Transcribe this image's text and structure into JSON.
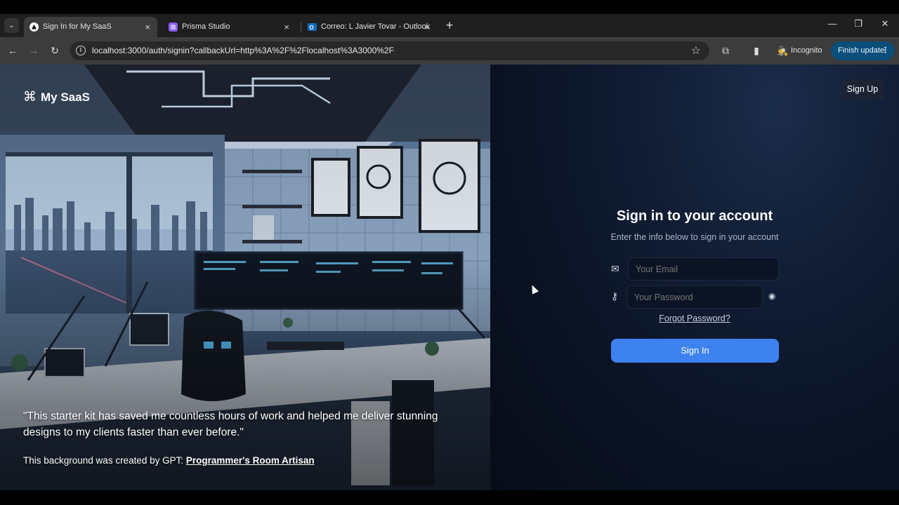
{
  "browser": {
    "tabs": [
      {
        "title": "Sign In for My SaaS",
        "close": "×"
      },
      {
        "title": "Prisma Studio",
        "close": "×"
      },
      {
        "title": "Correo: L Javier Tovar - Outlook",
        "close": "×"
      }
    ],
    "new_tab": "+",
    "url": "localhost:3000/auth/signin?callbackUrl=http%3A%2F%2Flocalhost%3A3000%2F",
    "incognito_label": "Incognito",
    "finish_update_label": "Finish update",
    "icons": {
      "back": "←",
      "forward": "→",
      "reload": "↻",
      "info": "i",
      "star": "☆",
      "extensions": "⧉",
      "sidepanel": "▮",
      "incognito": "🕵",
      "menu_dots": "⋮",
      "tab_dropdown": "⌄",
      "minimize": "—",
      "restore": "❐",
      "close": "✕"
    }
  },
  "page": {
    "brand": {
      "glyph": "⌘",
      "name": "My SaaS"
    },
    "quote": "\"This starter kit has saved me countless hours of work and helped me deliver stunning designs to my clients faster than ever before.\"",
    "credit_prefix": "This background was created by GPT: ",
    "credit_link": "Programmer's Room Artisan",
    "signup_label": "Sign Up",
    "form": {
      "title": "Sign in to your account",
      "subtitle": "Enter the info below to sign in your account",
      "email_placeholder": "Your Email",
      "password_placeholder": "Your Password",
      "forgot_label": "Forgot Password?",
      "submit_label": "Sign In",
      "icons": {
        "mail": "✉",
        "key": "⚷",
        "eye": "◉"
      }
    }
  },
  "colors": {
    "accent": "#3e82f0",
    "page_bg": "#0a1222"
  }
}
